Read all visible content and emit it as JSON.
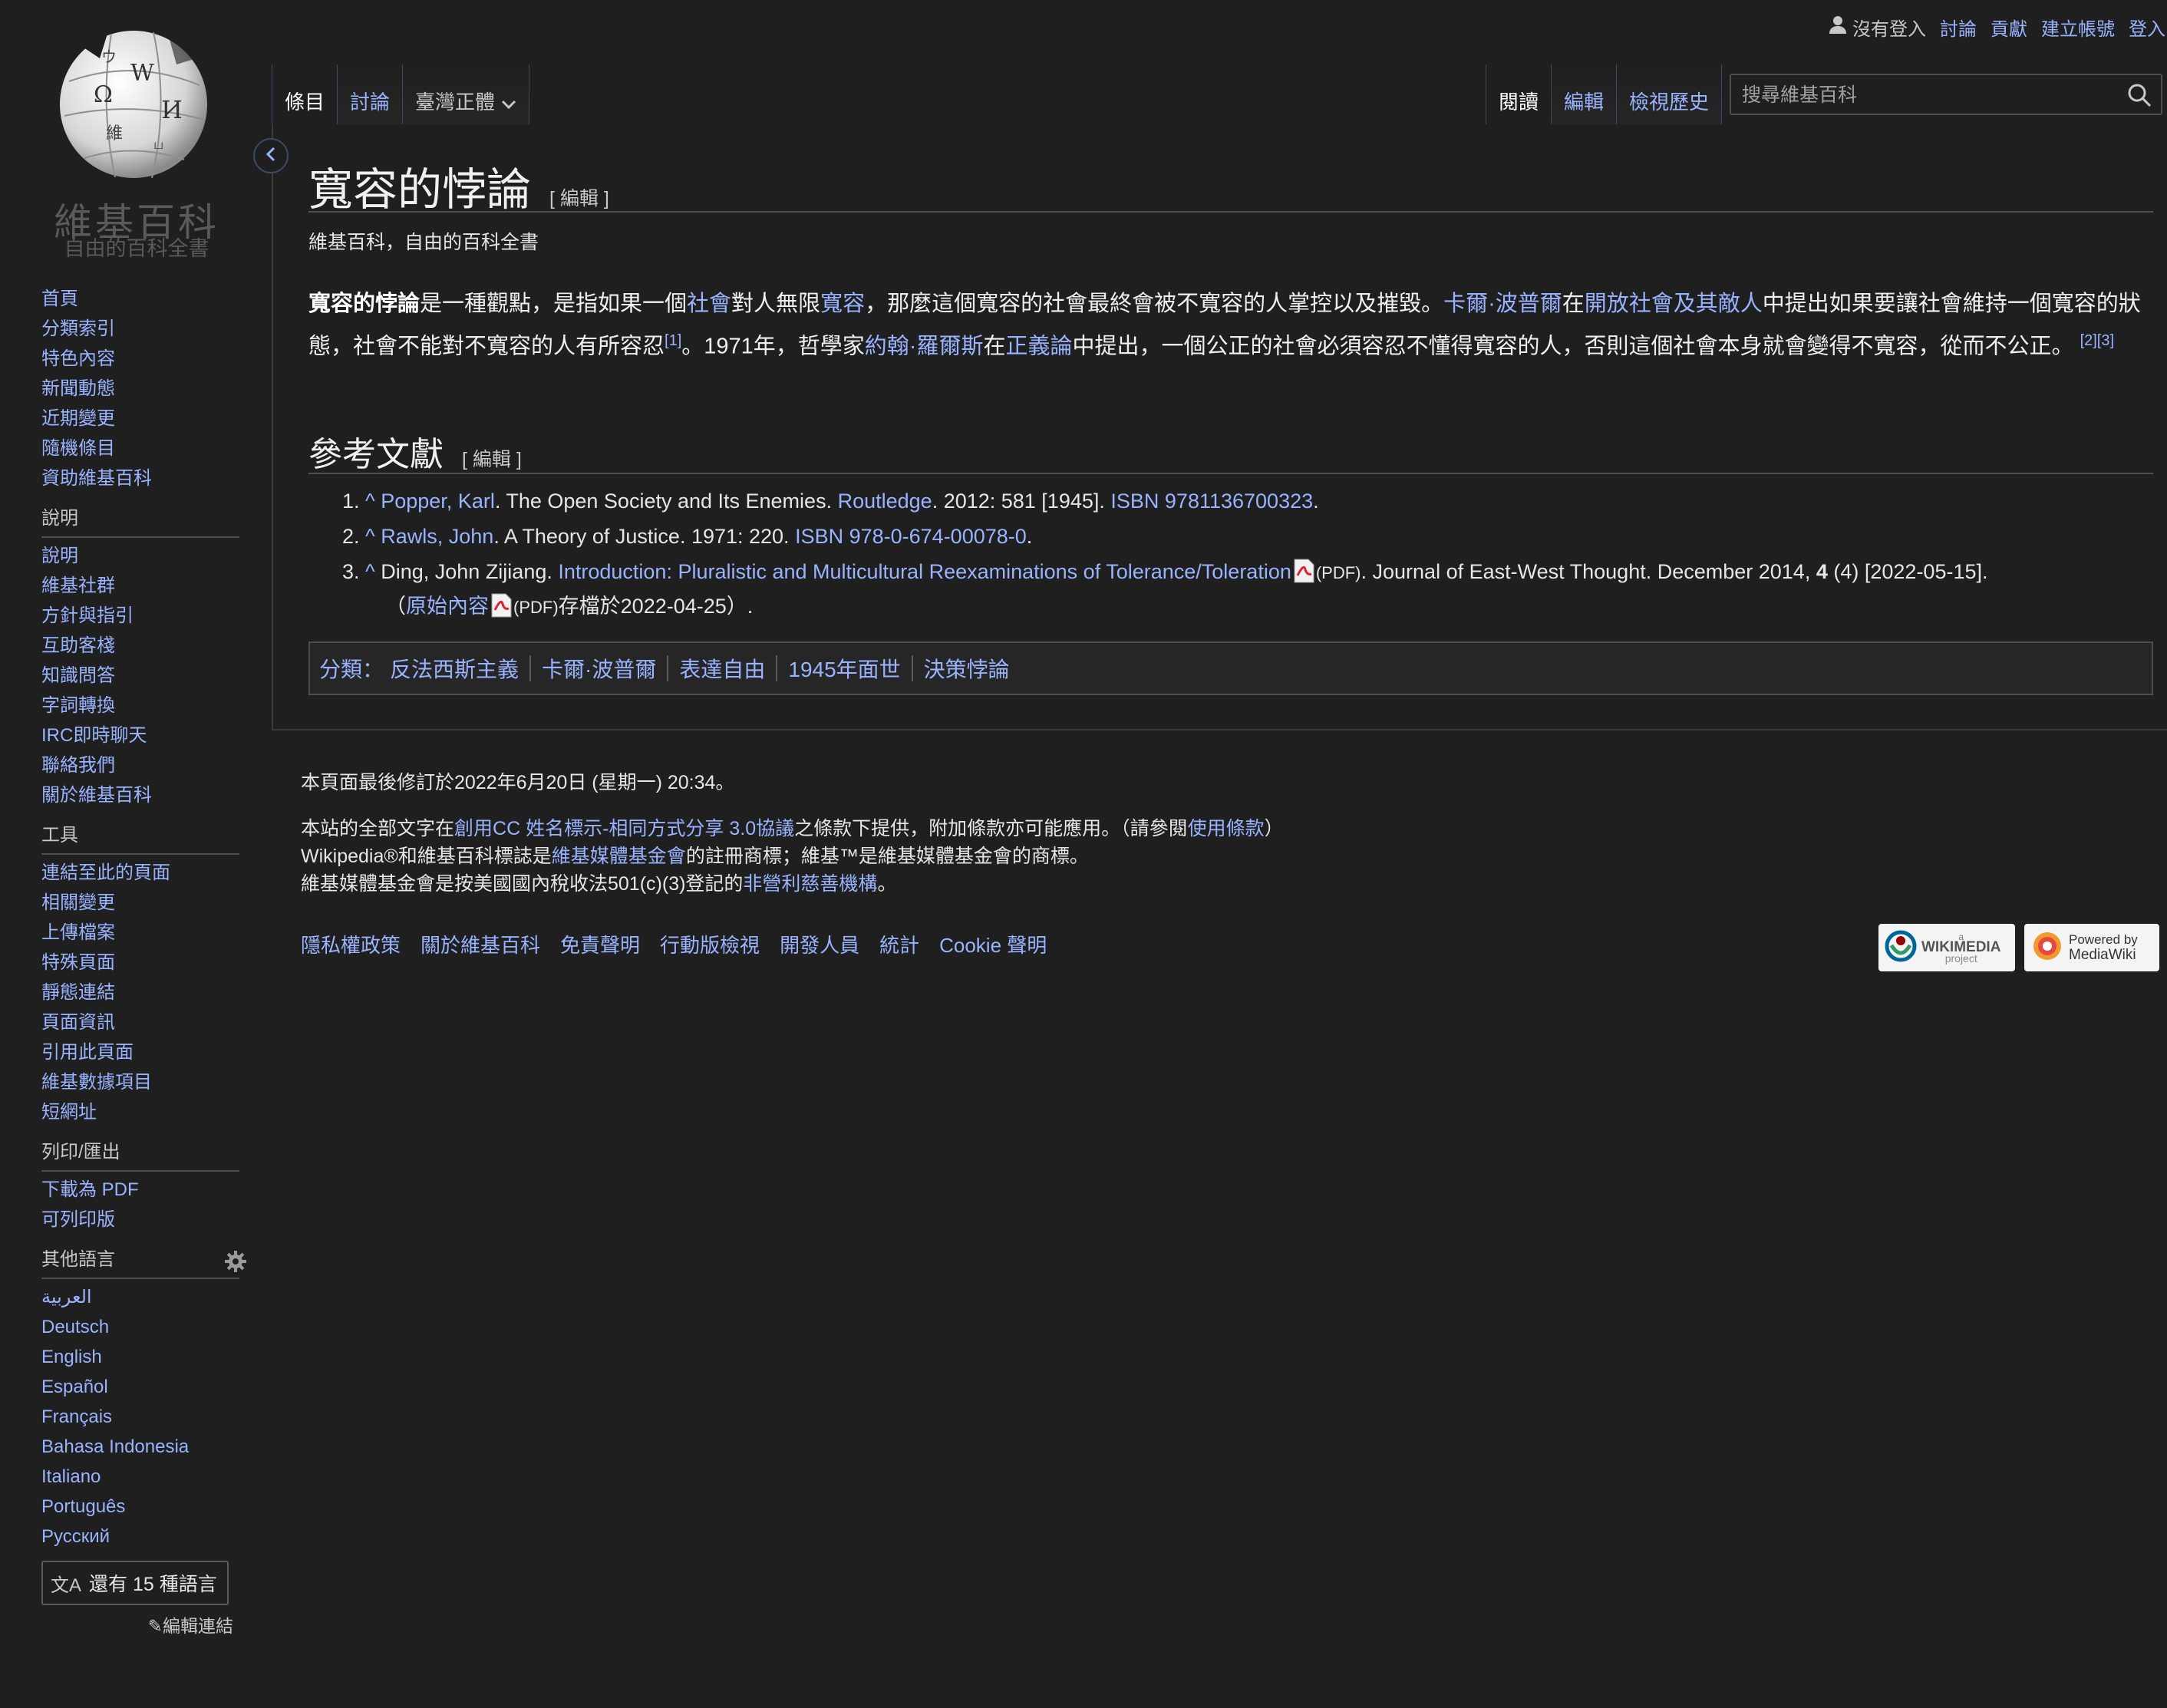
{
  "personal": {
    "not_logged_in": "沒有登入",
    "talk": "討論",
    "contributions": "貢獻",
    "create_account": "建立帳號",
    "login": "登入"
  },
  "logo": {
    "wordmark": "維基百科",
    "tagline": "自由的百科全書",
    "globe_glyphs": [
      "Ω",
      "W",
      "И",
      "維",
      "ウ",
      "ப"
    ]
  },
  "tabs": {
    "article": "條目",
    "talk": "討論",
    "variant": "臺灣正體",
    "read": "閱讀",
    "edit": "編輯",
    "history": "檢視歷史"
  },
  "search": {
    "placeholder": "搜尋維基百科"
  },
  "sidebar": {
    "nav": [
      "首頁",
      "分類索引",
      "特色內容",
      "新聞動態",
      "近期變更",
      "隨機條目",
      "資助維基百科"
    ],
    "help_heading": "說明",
    "help": [
      "說明",
      "維基社群",
      "方針與指引",
      "互助客棧",
      "知識問答",
      "字詞轉換",
      "IRC即時聊天",
      "聯絡我們",
      "關於維基百科"
    ],
    "tools_heading": "工具",
    "tools": [
      "連結至此的頁面",
      "相關變更",
      "上傳檔案",
      "特殊頁面",
      "靜態連結",
      "頁面資訊",
      "引用此頁面",
      "維基數據項目",
      "短網址"
    ],
    "print_heading": "列印/匯出",
    "print": [
      "下載為 PDF",
      "可列印版"
    ],
    "lang_heading": "其他語言",
    "languages": [
      "العربية",
      "Deutsch",
      "English",
      "Español",
      "Français",
      "Bahasa Indonesia",
      "Italiano",
      "Português",
      "Русский"
    ],
    "more_languages": "還有 15 種語言",
    "edit_links": "編輯連結"
  },
  "article": {
    "title": "寬容的悖論",
    "edit_section": "[ 編輯 ]",
    "tagline": "維基百科，自由的百科全書",
    "p_bold": "寬容的悖論",
    "p_1": "是一種觀點，是指如果一個",
    "l_society": "社會",
    "p_2": "對人無限",
    "l_tolerance": "寬容",
    "p_3": "，那麼這個寬容的社會最終會被不寬容的人掌控以及摧毀。",
    "l_popper": "卡爾·波普爾",
    "p_4": "在",
    "l_open_society": "開放社會及其敵人",
    "p_5": "中提出如果要讓社會維持一個寬容的狀態，社會不能對不寬容的人有所容忍",
    "ref1": "[1]",
    "p_6": "。1971年，哲學家",
    "l_rawls": "約翰·羅爾斯",
    "p_7": "在",
    "l_justice": "正義論",
    "p_8": "中提出，一個公正的社會必須容忍不懂得寬容的人，否則這個社會本身就會變得不寬容，從而不公正。",
    "ref23": "[2][3]",
    "refs_heading": "參考文獻"
  },
  "references": [
    {
      "num": "1.",
      "caret": "^",
      "author": "Popper, Karl",
      "text_a": ". The Open Society and Its Enemies. ",
      "publisher": "Routledge",
      "text_b": ". 2012: 581 [1945]. ",
      "isbn": "ISBN 9781136700323",
      "end": "."
    },
    {
      "num": "2.",
      "caret": "^",
      "author": "Rawls, John",
      "text_a": ". A Theory of Justice. 1971: 220. ",
      "isbn": "ISBN 978-0-674-00078-0",
      "end": "."
    },
    {
      "num": "3.",
      "caret": "^",
      "text_a": "Ding, John Zijiang. ",
      "title_link": "Introduction: Pluralistic and Multicultural Reexaminations of Tolerance/Toleration",
      "pdf": "(PDF)",
      "text_b": ". Journal of East-West Thought. December 2014, ",
      "vol": "4",
      "text_c": " (4) [2022-05-15].",
      "line2_open": "（",
      "orig_link": "原始內容",
      "pdf2": "(PDF)",
      "line2_rest": "存檔於2022-04-25）."
    }
  ],
  "categories": {
    "label": "分類：",
    "items": [
      "反法西斯主義",
      "卡爾·波普爾",
      "表達自由",
      "1945年面世",
      "決策悖論"
    ]
  },
  "footer": {
    "last_modified": "本頁面最後修訂於2022年6月20日 (星期一) 20:34。",
    "license_1": "本站的全部文字在",
    "license_link": "創用CC 姓名標示-相同方式分享 3.0協議",
    "license_2": "之條款下提供，附加條款亦可能應用。（請參閱",
    "terms_link": "使用條款",
    "license_3": "）",
    "trademark_1": "Wikipedia®和維基百科標誌是",
    "wmf_link": "維基媒體基金會",
    "trademark_2": "的註冊商標；維基™是維基媒體基金會的商標。",
    "nonprofit_1": "維基媒體基金會是按美國國內稅收法501(c)(3)登記的",
    "nonprofit_link": "非營利慈善機構",
    "nonprofit_2": "。",
    "links": [
      "隱私權政策",
      "關於維基百科",
      "免責聲明",
      "行動版檢視",
      "開發人員",
      "統計",
      "Cookie 聲明"
    ],
    "badge_wikimedia": "WIKIMEDIA",
    "badge_wikimedia_small": "a",
    "badge_wikimedia_sub": "project",
    "badge_mediawiki_1": "Powered by",
    "badge_mediawiki_2": "MediaWiki"
  }
}
